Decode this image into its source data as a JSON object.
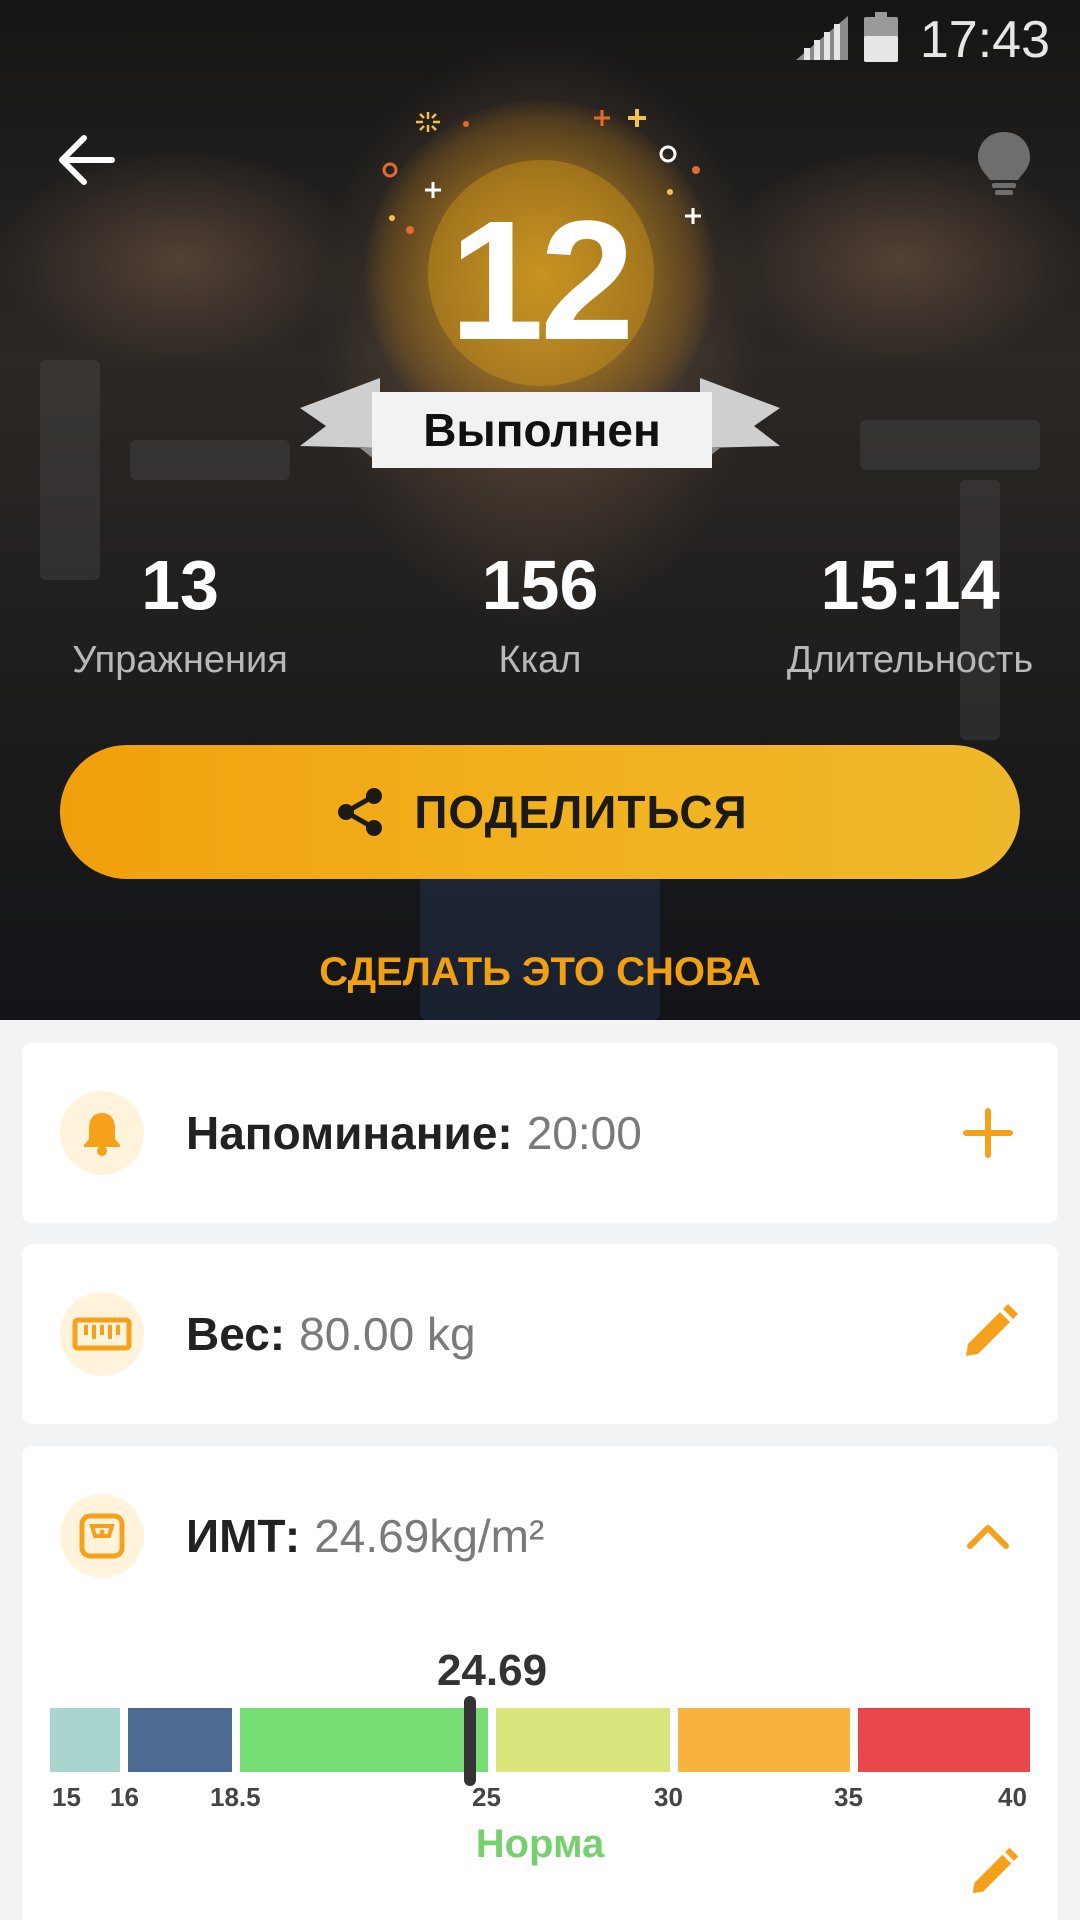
{
  "status_bar": {
    "time": "17:43"
  },
  "hero": {
    "completed_count": "12",
    "completed_label": "Выполнен",
    "stats": [
      {
        "value": "13",
        "label": "Упражнения"
      },
      {
        "value": "156",
        "label": "Ккал"
      },
      {
        "value": "15:14",
        "label": "Длительность"
      }
    ],
    "share_button_label": "ПОДЕЛИТЬСЯ",
    "repeat_link_label": "СДЕЛАТЬ ЭТО СНОВА"
  },
  "reminder": {
    "label": "Напоминание:",
    "value": "20:00"
  },
  "weight": {
    "label": "Вес:",
    "value": "80.00 kg"
  },
  "bmi": {
    "label": "ИМТ:",
    "value": "24.69kg/m²",
    "marker_value": "24.69",
    "scale_ticks": [
      "15",
      "16",
      "18.5",
      "25",
      "30",
      "35",
      "40"
    ],
    "status": "Норма",
    "segment_colors": [
      "#a9d5cf",
      "#4b6b93",
      "#76dc74",
      "#d9e57c",
      "#f8b23f",
      "#e8464b"
    ]
  },
  "colors": {
    "accent": "#f2a81b",
    "accent_light": "#fff3dc",
    "bmi_normal": "#76d06e"
  }
}
